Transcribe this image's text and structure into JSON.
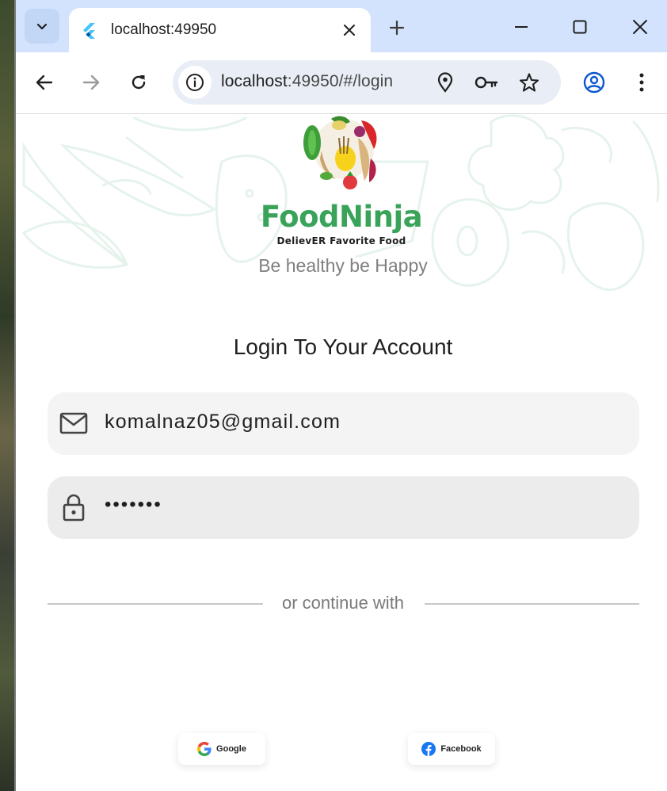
{
  "browser": {
    "tab": {
      "title": "localhost:49950"
    },
    "omnibox": {
      "host": "localhost",
      "rest": ":49950/#/login"
    }
  },
  "app": {
    "brand": "FoodNinja",
    "subbrand": "DelievER Favorite Food",
    "tagline": "Be healthy be Happy",
    "heading": "Login To Your Account",
    "email": {
      "value": "komalnaz05@gmail.com"
    },
    "password": {
      "value": "•••••••"
    },
    "divider_text": "or continue with",
    "google_label": "Google",
    "facebook_label": "Facebook"
  },
  "colors": {
    "brand_green": "#3aa35a",
    "tabstrip": "#d3e3fd",
    "facebook_blue": "#1877f2",
    "accent_blue": "#0b57d0"
  }
}
